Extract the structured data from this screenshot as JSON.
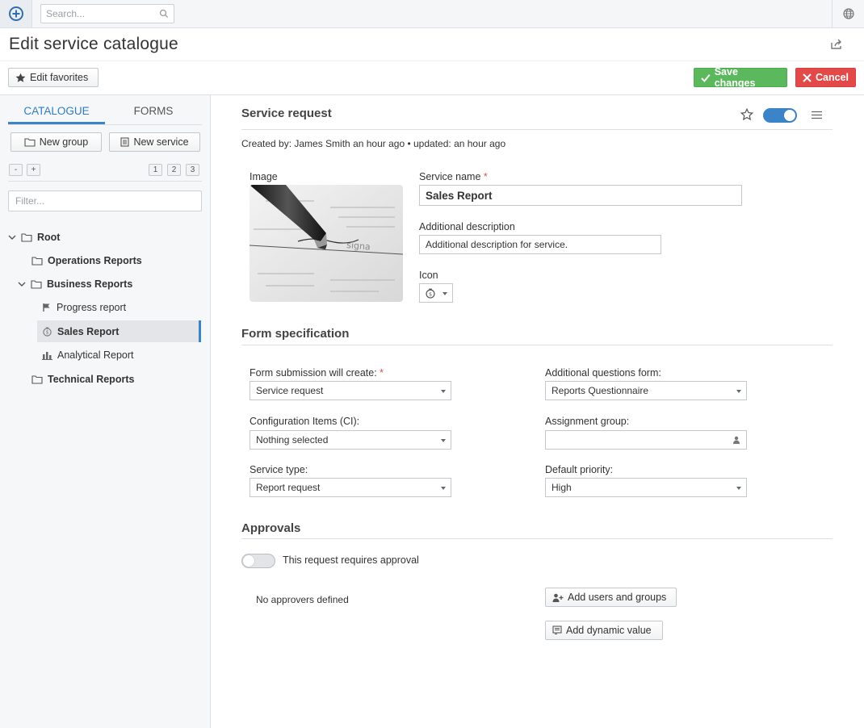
{
  "topbar": {
    "search_placeholder": "Search..."
  },
  "page": {
    "title": "Edit service catalogue"
  },
  "toolbar": {
    "edit_favorites": "Edit favorites",
    "save_changes": "Save changes",
    "cancel": "Cancel"
  },
  "sidebar": {
    "tabs": [
      "CATALOGUE",
      "FORMS"
    ],
    "new_group": "New group",
    "new_service": "New service",
    "collapse": "-",
    "expand": "+",
    "levels": [
      "1",
      "2",
      "3"
    ],
    "filter_placeholder": "Filter...",
    "tree": [
      {
        "label": "Root"
      },
      {
        "label": "Operations Reports"
      },
      {
        "label": "Business Reports"
      },
      {
        "label": "Progress report"
      },
      {
        "label": "Sales Report"
      },
      {
        "label": "Analytical Report"
      },
      {
        "label": "Technical Reports"
      }
    ]
  },
  "service": {
    "header": "Service request",
    "created_by": "Created by: James Smith",
    "created_time": "an hour ago",
    "updated_label": "• updated:",
    "updated_time": "an hour ago",
    "image_label": "Image",
    "name_label": "Service name",
    "name_value": "Sales Report",
    "desc_label": "Additional description",
    "desc_value": "Additional description for service.",
    "icon_label": "Icon",
    "enabled": true
  },
  "form_spec": {
    "title": "Form specification",
    "submission_label": "Form submission will create:",
    "submission_value": "Service request",
    "questions_label": "Additional questions form:",
    "questions_value": "Reports Questionnaire",
    "ci_label": "Configuration Items (CI):",
    "ci_value": "Nothing selected",
    "assignment_label": "Assignment group:",
    "assignment_value": "",
    "service_type_label": "Service type:",
    "service_type_value": "Report request",
    "priority_label": "Default priority:",
    "priority_value": "High"
  },
  "approvals": {
    "title": "Approvals",
    "toggle_label": "This request requires approval",
    "requires_approval": false,
    "no_approvers": "No approvers defined",
    "add_users": "Add users and groups",
    "add_dynamic": "Add dynamic value"
  },
  "colors": {
    "accent": "#3b84c8",
    "save": "#5cb85c",
    "cancel": "#e4494a",
    "required": "#d9534f"
  }
}
